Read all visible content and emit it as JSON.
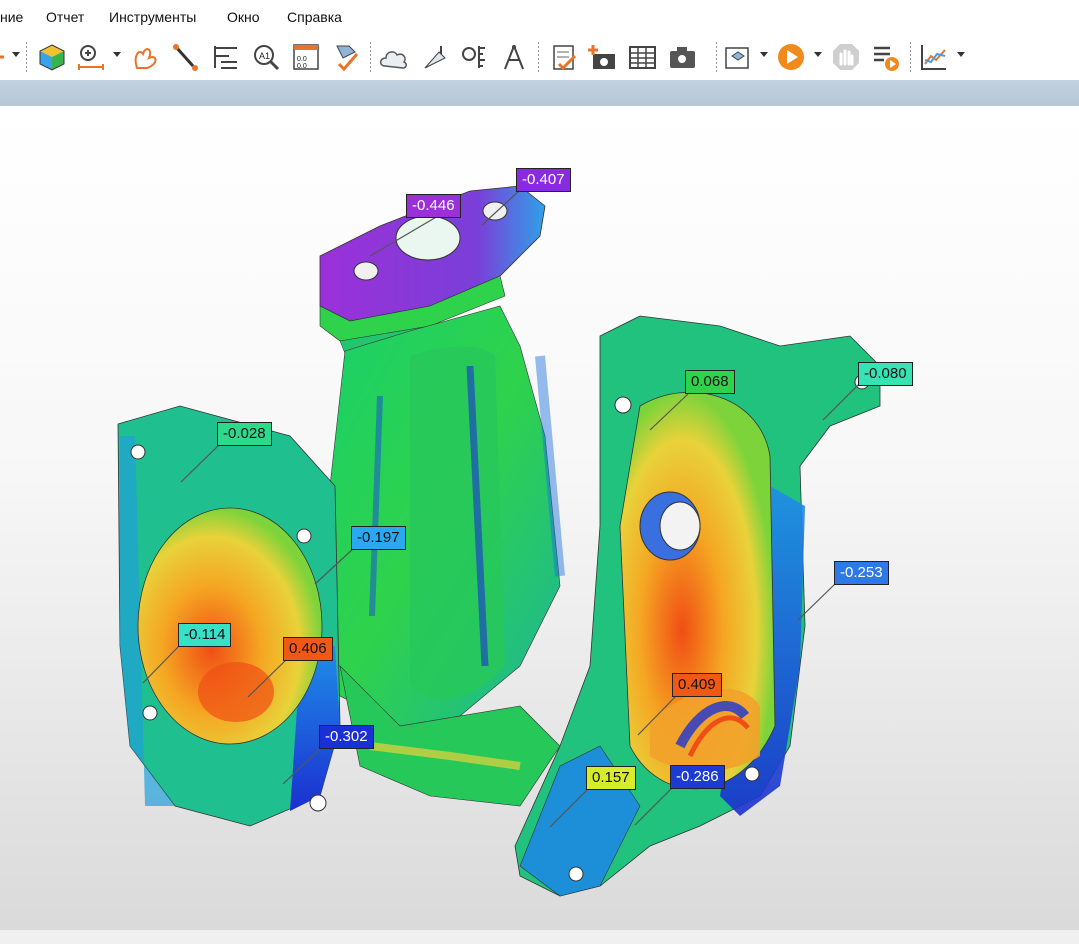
{
  "menu": {
    "items": [
      "ние",
      "Отчет",
      "Инструменты",
      "Окно",
      "Справка"
    ]
  },
  "toolbar": {
    "icons": [
      "color-map-cube-icon",
      "measure-points-icon",
      "flower-curves-icon",
      "probe-icon",
      "caliper-icon",
      "annotation-magnifier-icon",
      "grid-points-icon",
      "alignment-check-icon",
      "cloud-icon",
      "gauge-icon",
      "scale-ruler-icon",
      "compass-icon",
      "clipboard-check-icon",
      "add-camera-icon",
      "table-icon",
      "camera-icon",
      "report-3d-icon",
      "play-icon",
      "stop-hand-icon",
      "play-list-icon",
      "chart-icon"
    ]
  },
  "deviation_labels": [
    {
      "id": "l1",
      "value": "-0.407",
      "color": "#8a2be2",
      "text_color": "#ffffff"
    },
    {
      "id": "l2",
      "value": "-0.446",
      "color": "#9b30d9",
      "text_color": "#ffffff"
    },
    {
      "id": "l3",
      "value": "-0.080",
      "color": "#37e3b5",
      "text_color": "#111111"
    },
    {
      "id": "l4",
      "value": "0.068",
      "color": "#2fd24b",
      "text_color": "#111111"
    },
    {
      "id": "l5",
      "value": "-0.028",
      "color": "#2fd98c",
      "text_color": "#111111"
    },
    {
      "id": "l6",
      "value": "-0.197",
      "color": "#2aa8f0",
      "text_color": "#111111"
    },
    {
      "id": "l7",
      "value": "-0.253",
      "color": "#2e79e8",
      "text_color": "#ffffff"
    },
    {
      "id": "l8",
      "value": "-0.114",
      "color": "#37e0c7",
      "text_color": "#111111"
    },
    {
      "id": "l9",
      "value": "0.406",
      "color": "#ee5a16",
      "text_color": "#111111"
    },
    {
      "id": "l10",
      "value": "0.409",
      "color": "#ee5a16",
      "text_color": "#111111"
    },
    {
      "id": "l11",
      "value": "-0.302",
      "color": "#1a2fd6",
      "text_color": "#ffffff"
    },
    {
      "id": "l12",
      "value": "0.157",
      "color": "#d7ec2b",
      "text_color": "#111111"
    },
    {
      "id": "l13",
      "value": "-0.286",
      "color": "#1c3bd0",
      "text_color": "#ffffff"
    }
  ]
}
